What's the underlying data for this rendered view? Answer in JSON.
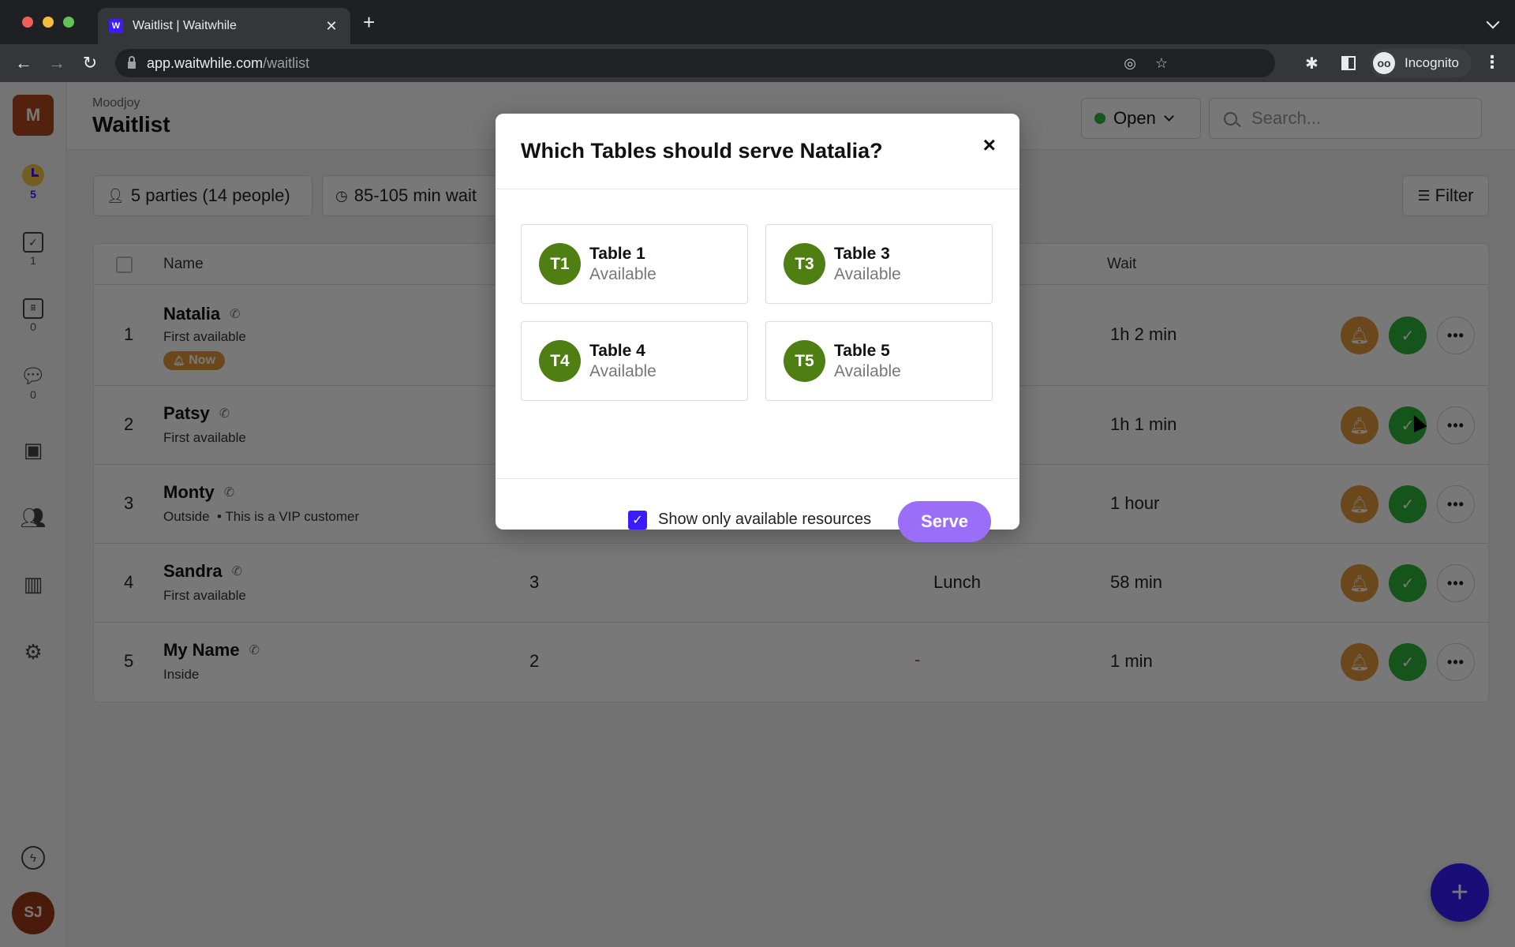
{
  "browser": {
    "tab_title": "Waitlist | Waitwhile",
    "favicon_letter": "W",
    "url_host": "app.waitwhile.com",
    "url_path": "/waitlist",
    "profile_label": "Incognito",
    "icons": {
      "back": "arrow-left-icon",
      "forward": "arrow-right-icon",
      "reload": "reload-icon",
      "lock": "lock-icon",
      "eye_off": "eye-off-icon",
      "star": "star-icon",
      "extensions": "puzzle-icon",
      "side_panel": "side-panel-icon",
      "menu": "kebab-menu-icon"
    }
  },
  "sidebar": {
    "org_initial": "M",
    "items": [
      {
        "name": "waitlist",
        "icon": "clock-icon",
        "count": "5",
        "active": true
      },
      {
        "name": "tasks",
        "icon": "checkbox-icon",
        "count": "1"
      },
      {
        "name": "bookings",
        "icon": "calendar-icon",
        "count": "0"
      },
      {
        "name": "messages",
        "icon": "chat-icon",
        "count": "0"
      },
      {
        "name": "resources",
        "icon": "grid-icon"
      },
      {
        "name": "customers",
        "icon": "users-icon"
      },
      {
        "name": "analytics",
        "icon": "bar-chart-icon"
      },
      {
        "name": "settings",
        "icon": "gear-icon"
      }
    ],
    "bottom": {
      "bolt_icon": "lightning-icon",
      "user_initials": "SJ"
    }
  },
  "header": {
    "org_name": "Moodjoy",
    "title": "Waitlist",
    "status_label": "Open",
    "status_color": "#2fb344",
    "search_placeholder": "Search..."
  },
  "summary": {
    "parties": "5 parties (14 people)",
    "wait": "85-105 min wait",
    "filter_label": "Filter"
  },
  "table": {
    "columns": {
      "name": "Name",
      "wait": "Wait"
    },
    "rows": [
      {
        "num": "1",
        "name": "Natalia",
        "sub": "First available",
        "badge": "Now",
        "size": "",
        "service": "",
        "wait": "1h 2 min"
      },
      {
        "num": "2",
        "name": "Patsy",
        "sub": "First available",
        "size": "",
        "service": "",
        "wait": "1h 1 min"
      },
      {
        "num": "3",
        "name": "Monty",
        "sub": "Outside  • This is a VIP customer",
        "size": "",
        "service": "",
        "wait": "1 hour"
      },
      {
        "num": "4",
        "name": "Sandra",
        "sub": "First available",
        "size": "3",
        "service": "Lunch",
        "wait": "58 min"
      },
      {
        "num": "5",
        "name": "My Name",
        "sub": "Inside",
        "size": "2",
        "service": "-",
        "wait": "1 min"
      }
    ],
    "action_more": "•••"
  },
  "modal": {
    "title": "Which Tables should serve Natalia?",
    "close": "×",
    "resources": [
      {
        "initials": "T1",
        "name": "Table 1",
        "status": "Available"
      },
      {
        "initials": "T3",
        "name": "Table 3",
        "status": "Available"
      },
      {
        "initials": "T4",
        "name": "Table 4",
        "status": "Available"
      },
      {
        "initials": "T5",
        "name": "Table 5",
        "status": "Available"
      }
    ],
    "show_available_label": "Show only available resources",
    "show_available_checked": true,
    "serve_label": "Serve"
  },
  "colors": {
    "brand": "#3b1cff",
    "serve_button": "#9a6ef7",
    "resource_avatar": "#4f7f12",
    "notify": "#e49a3b",
    "serve_action": "#2eb33a"
  },
  "fab": {
    "label": "+"
  }
}
